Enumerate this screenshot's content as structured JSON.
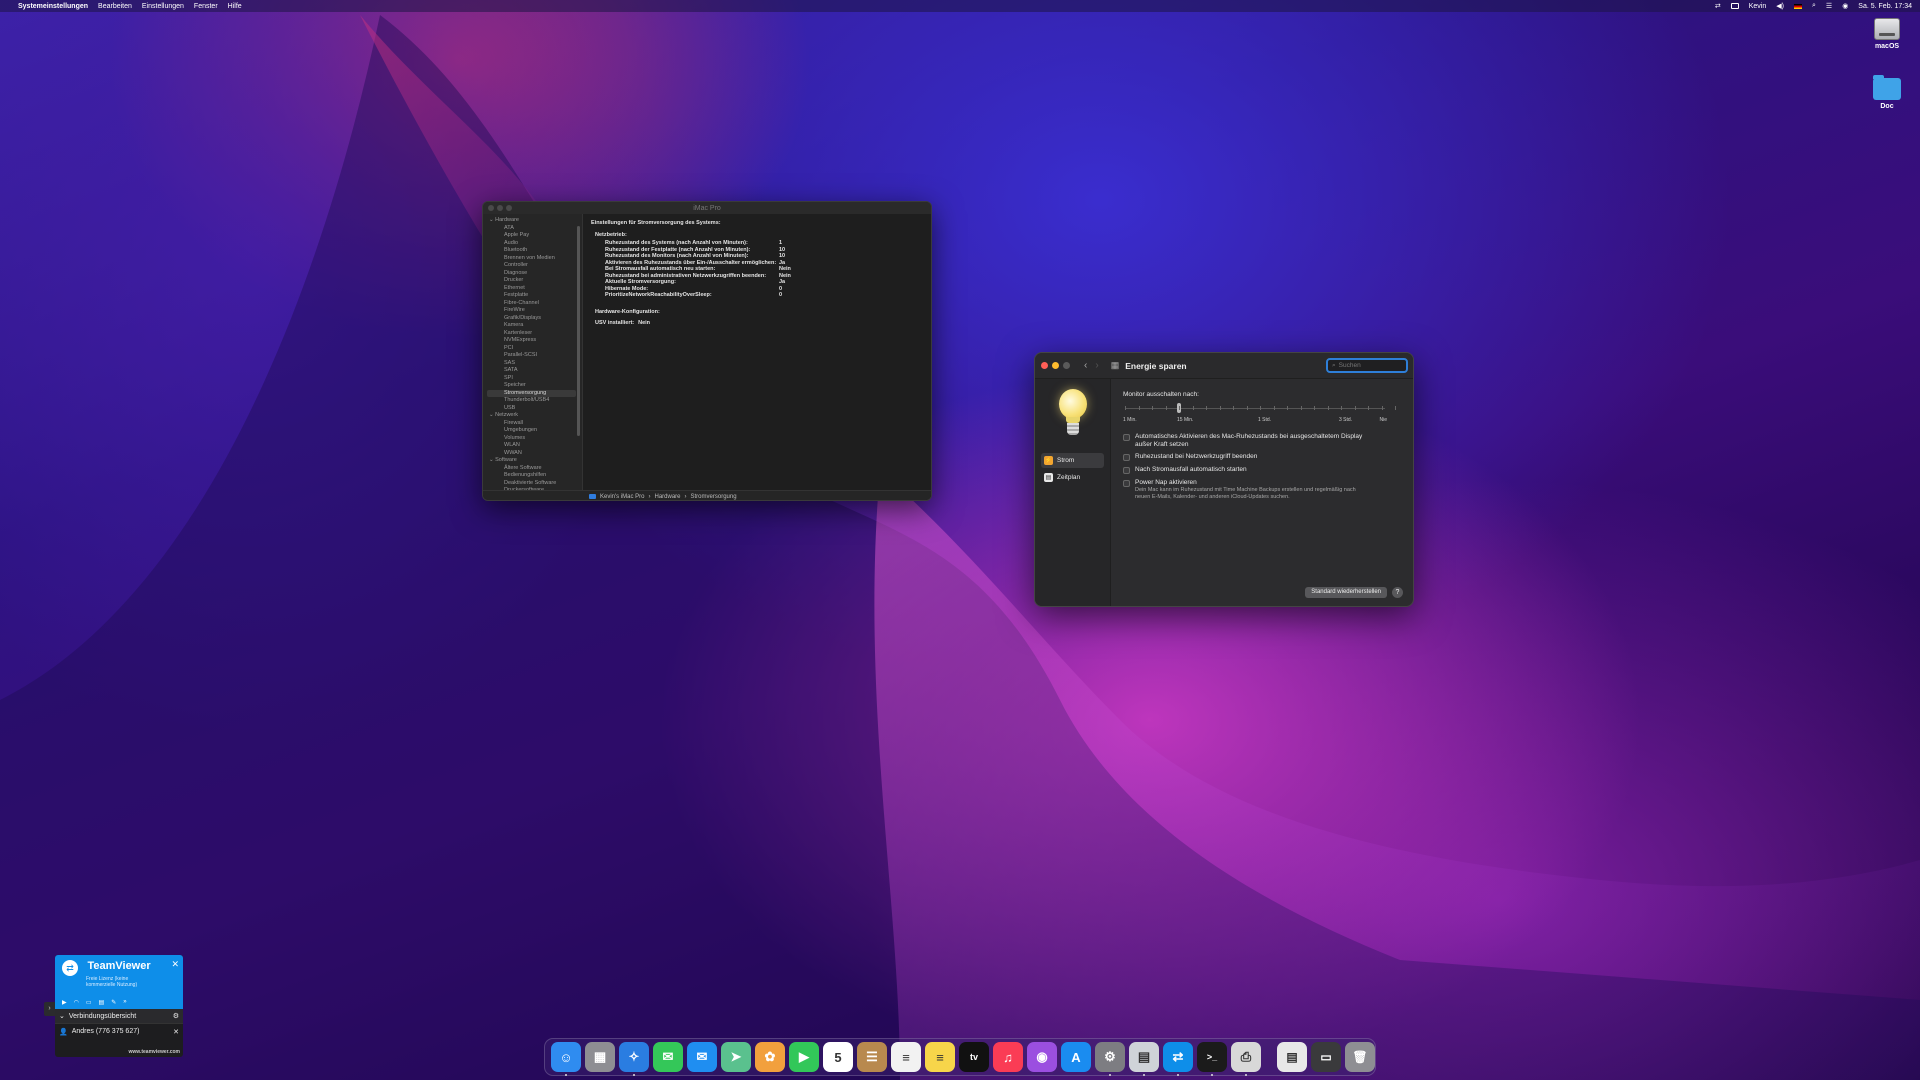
{
  "menubar": {
    "apple": "",
    "app_name": "Systemeinstellungen",
    "menus": [
      "Bearbeiten",
      "Einstellungen",
      "Fenster",
      "Hilfe"
    ],
    "user": "Kevin",
    "datetime": "Sa. 5. Feb. 17:34"
  },
  "desktop": {
    "disk_label": "macOS",
    "folder_label": "Doc"
  },
  "sysinfo": {
    "title": "iMac Pro",
    "sidebar": {
      "hardware_label": "Hardware",
      "hardware_items": [
        "ATA",
        "Apple Pay",
        "Audio",
        "Bluetooth",
        "Brennen von Medien",
        "Controller",
        "Diagnose",
        "Drucker",
        "Ethernet",
        "Festplatte",
        "Fibre-Channel",
        "FireWire",
        "Grafik/Displays",
        "Kamera",
        "Kartenleser",
        "NVMExpress",
        "PCI",
        "Parallel-SCSI",
        "SAS",
        "SATA",
        "SPI",
        "Speicher",
        "Stromversorgung",
        "Thunderbolt/USB4",
        "USB"
      ],
      "network_label": "Netzwerk",
      "network_items": [
        "Firewall",
        "Umgebungen",
        "Volumes",
        "WLAN",
        "WWAN"
      ],
      "software_label": "Software",
      "software_items": [
        "Ältere Software",
        "Bedienungshilfen",
        "Deaktivierte Software",
        "Druckersoftware",
        "Entwickler"
      ]
    },
    "content": {
      "heading": "Einstellungen für Stromversorgung des Systems:",
      "section": "Netzbetrieb:",
      "rows": [
        {
          "k": "Ruhezustand des Systems (nach Anzahl von Minuten):",
          "v": "1"
        },
        {
          "k": "Ruhezustand der Festplatte (nach Anzahl von Minuten):",
          "v": "10"
        },
        {
          "k": "Ruhezustand des Monitors (nach Anzahl von Minuten):",
          "v": "10"
        },
        {
          "k": "Aktivieren des Ruhezustands über Ein-/Ausschalter ermöglichen:",
          "v": "Ja"
        },
        {
          "k": "Bei Stromausfall automatisch neu starten:",
          "v": "Nein"
        },
        {
          "k": "Ruhezustand bei administrativen Netzwerkzugriffen beenden:",
          "v": "Nein"
        },
        {
          "k": "Aktuelle Stromversorgung:",
          "v": "Ja"
        },
        {
          "k": "Hibernate Mode:",
          "v": "0"
        },
        {
          "k": "PrioritizeNetworkReachabilityOverSleep:",
          "v": "0"
        }
      ],
      "hw_heading": "Hardware-Konfiguration:",
      "usv_key": "USV installiert:",
      "usv_val": "Nein"
    },
    "path": [
      "Kevin's iMac Pro",
      "Hardware",
      "Stromversorgung"
    ]
  },
  "energy": {
    "title": "Energie sparen",
    "search_placeholder": "Suchen",
    "nav": [
      {
        "label": "Strom",
        "icon": "bolt-icon"
      },
      {
        "label": "Zeitplan",
        "icon": "calendar-icon"
      }
    ],
    "slider_label": "Monitor ausschalten nach:",
    "slider_ticks": [
      "1 Min.",
      "15 Min.",
      "1 Std.",
      "3 Std.",
      "Nie"
    ],
    "slider_value_fraction": 0.2,
    "checks": [
      "Automatisches Aktivieren des Mac-Ruhezustands bei ausgeschaltetem Display außer Kraft setzen",
      "Ruhezustand bei Netzwerkzugriff beenden",
      "Nach Stromausfall automatisch starten",
      "Power Nap aktivieren"
    ],
    "powernap_note": "Dein Mac kann im Ruhezustand mit Time Machine Backups erstellen und regelmäßig nach neuen E-Mails, Kalender- und anderen iCloud-Updates suchen.",
    "restore_label": "Standard wiederherstellen",
    "help_label": "?"
  },
  "teamviewer": {
    "brand": "TeamViewer",
    "license": "Freie Lizenz (keine kommerzielle Nutzung)",
    "overview": "Verbindungsübersicht",
    "contact": "Andres (776 375 627)",
    "footer": "www.teamviewer.com"
  },
  "dock": {
    "apps": [
      {
        "name": "finder",
        "color": "#2f8cf0",
        "glyph": "☺",
        "running": true
      },
      {
        "name": "launchpad",
        "color": "#8e8e93",
        "glyph": "▦",
        "running": false
      },
      {
        "name": "safari",
        "color": "#2a7de1",
        "glyph": "✧",
        "running": true
      },
      {
        "name": "messages",
        "color": "#34c759",
        "glyph": "✉",
        "running": false
      },
      {
        "name": "mail",
        "color": "#1f8ef1",
        "glyph": "✉",
        "running": false
      },
      {
        "name": "maps",
        "color": "#5ac18e",
        "glyph": "➤",
        "running": false
      },
      {
        "name": "photos",
        "color": "#f2a03d",
        "glyph": "✿",
        "running": false
      },
      {
        "name": "facetime",
        "color": "#32c759",
        "glyph": "▶",
        "running": false
      },
      {
        "name": "calendar",
        "color": "#ffffff",
        "glyph": "5",
        "running": false
      },
      {
        "name": "contacts",
        "color": "#b8894e",
        "glyph": "☰",
        "running": false
      },
      {
        "name": "reminders",
        "color": "#f2f2f2",
        "glyph": "≡",
        "running": false
      },
      {
        "name": "notes",
        "color": "#f7d54a",
        "glyph": "≡",
        "running": false
      },
      {
        "name": "tv",
        "color": "#111111",
        "glyph": "tv",
        "running": false
      },
      {
        "name": "music",
        "color": "#fa3c55",
        "glyph": "♫",
        "running": false
      },
      {
        "name": "podcasts",
        "color": "#9b4fe0",
        "glyph": "◉",
        "running": false
      },
      {
        "name": "app-store",
        "color": "#1a8cf0",
        "glyph": "A",
        "running": false
      },
      {
        "name": "system-preferences",
        "color": "#7d7d82",
        "glyph": "⚙",
        "running": true
      },
      {
        "name": "system-information",
        "color": "#cfd3d8",
        "glyph": "▤",
        "running": true
      },
      {
        "name": "teamviewer",
        "color": "#0e8ee9",
        "glyph": "⇄",
        "running": true
      },
      {
        "name": "terminal",
        "color": "#1b1b1b",
        "glyph": ">_",
        "running": true
      },
      {
        "name": "printer",
        "color": "#d8d8d8",
        "glyph": "⎙",
        "running": true
      }
    ],
    "others": [
      {
        "name": "document",
        "color": "#e8e8e8",
        "glyph": "▤"
      },
      {
        "name": "downloads",
        "color": "#3a3a3c",
        "glyph": "▭"
      },
      {
        "name": "trash",
        "color": "#8e8e93",
        "glyph": "🗑"
      }
    ]
  },
  "colors": {
    "accent": "#2e7fd8",
    "teamviewer_blue": "#0e8ee9"
  }
}
